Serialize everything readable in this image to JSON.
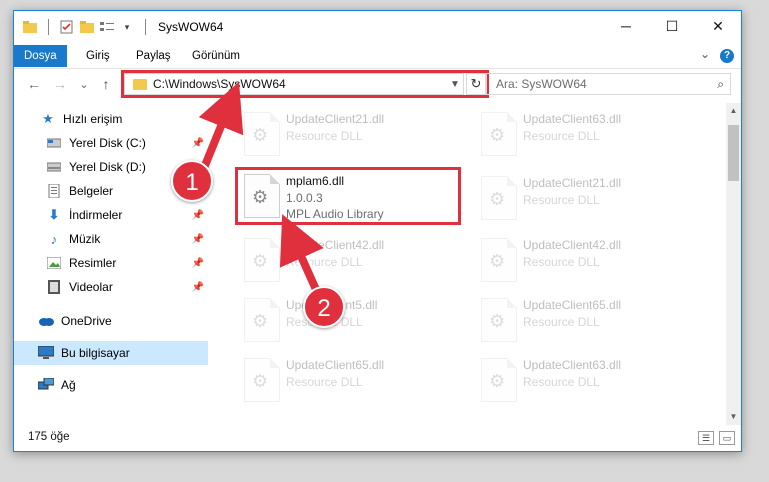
{
  "window": {
    "title": "SysWOW64",
    "controls": {
      "minimize": "─",
      "maximize": "☐",
      "close": "✕"
    }
  },
  "ribbon": {
    "tabs": [
      "Dosya",
      "Giriş",
      "Paylaş",
      "Görünüm"
    ],
    "expand": "⌄",
    "help": "?"
  },
  "nav": {
    "back": "←",
    "forward": "→",
    "recent": "⌄",
    "up": "↑",
    "address_path": "C:\\Windows\\SysWOW64",
    "refresh": "↻",
    "search_placeholder": "Ara: SysWOW64",
    "search_icon": "⌕"
  },
  "sidebar": {
    "items": [
      {
        "label": "Hızlı erişim",
        "icon": "star-icon"
      },
      {
        "label": "Yerel Disk (C:)",
        "icon": "drive-icon",
        "pinned": true
      },
      {
        "label": "Yerel Disk (D:)",
        "icon": "drive-icon",
        "pinned": true
      },
      {
        "label": "Belgeler",
        "icon": "documents-icon",
        "pinned": true
      },
      {
        "label": "İndirmeler",
        "icon": "downloads-icon",
        "pinned": true
      },
      {
        "label": "Müzik",
        "icon": "music-icon",
        "pinned": true
      },
      {
        "label": "Resimler",
        "icon": "pictures-icon",
        "pinned": true
      },
      {
        "label": "Videolar",
        "icon": "videos-icon",
        "pinned": true
      },
      {
        "label": "OneDrive",
        "icon": "onedrive-icon"
      },
      {
        "label": "Bu bilgisayar",
        "icon": "computer-icon",
        "selected": true
      },
      {
        "label": "Ağ",
        "icon": "network-icon"
      }
    ]
  },
  "files": {
    "highlighted": {
      "name": "mplam6.dll",
      "version": "1.0.0.3",
      "description": "MPL Audio Library"
    },
    "left_column": [
      {
        "name": "UpdateClient21.dll",
        "type": "Resource DLL"
      },
      {
        "name": "UpdateClient42.dll",
        "type": "Resource DLL"
      },
      {
        "name": "UpdateClient5.dll",
        "type": "Resource DLL"
      },
      {
        "name": "UpdateClient65.dll",
        "type": "Resource DLL"
      }
    ],
    "right_column": [
      {
        "name": "UpdateClient63.dll",
        "type": "Resource DLL"
      },
      {
        "name": "UpdateClient21.dll",
        "type": "Resource DLL"
      },
      {
        "name": "UpdateClient42.dll",
        "type": "Resource DLL"
      },
      {
        "name": "UpdateClient65.dll",
        "type": "Resource DLL"
      },
      {
        "name": "UpdateClient63.dll",
        "type": "Resource DLL"
      }
    ]
  },
  "status": {
    "item_count": "175 öğe"
  },
  "callouts": [
    "1",
    "2"
  ],
  "colors": {
    "accent": "#1979ca",
    "highlight": "#e0303d",
    "selected_bg": "#cce8ff"
  }
}
